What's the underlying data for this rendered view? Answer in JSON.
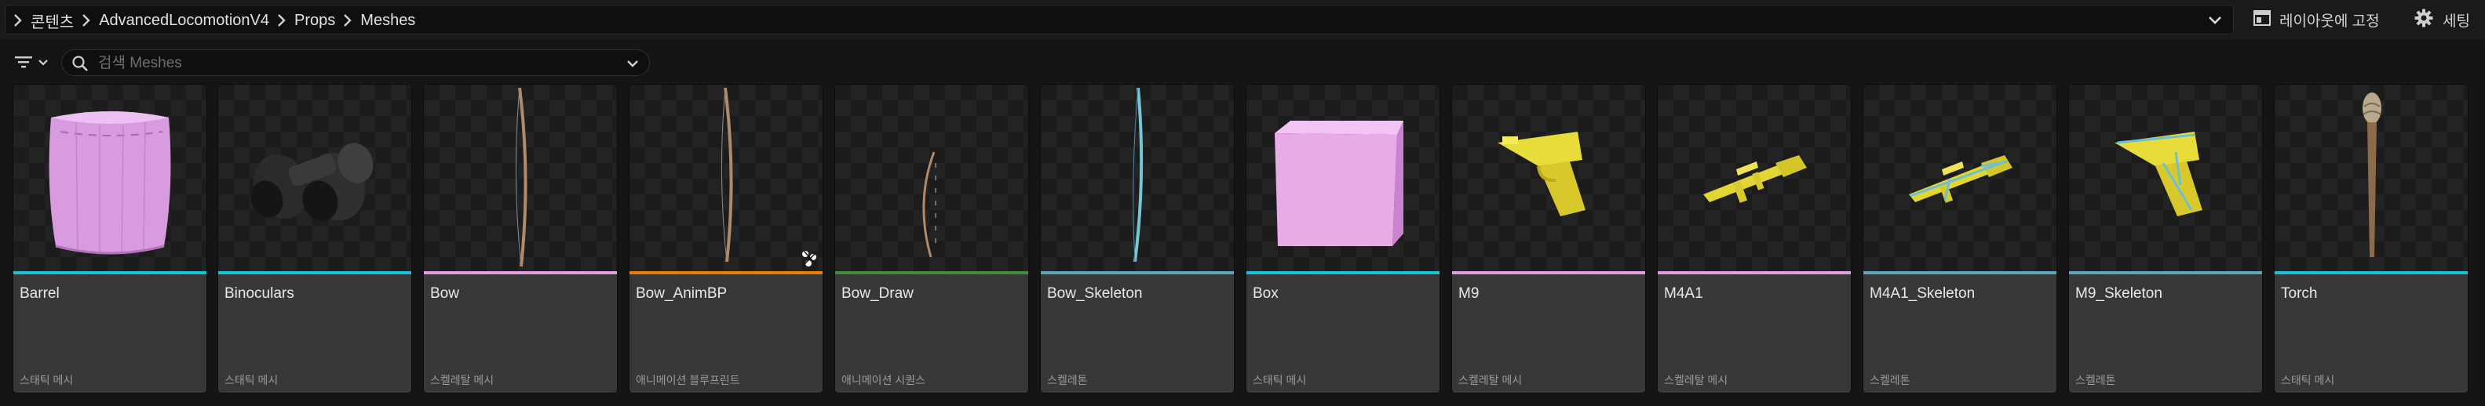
{
  "breadcrumb": {
    "items": [
      "콘텐츠",
      "AdvancedLocomotionV4",
      "Props",
      "Meshes"
    ]
  },
  "toolbar": {
    "lock_layout_label": "레이아웃에 고정",
    "settings_label": "세팅"
  },
  "search": {
    "placeholder": "검색 Meshes",
    "value": ""
  },
  "colors": {
    "static_mesh": "#19c2d6",
    "skeletal_mesh": "#e59ae6",
    "anim_blueprint": "#e67e00",
    "anim_sequence": "#3f8f3a",
    "skeleton": "#5fa4bd"
  },
  "assets": [
    {
      "name": "Barrel",
      "type": "스태틱 메시",
      "type_color": "#19c2d6",
      "thumbnail": "barrel-thumbnail"
    },
    {
      "name": "Binoculars",
      "type": "스태틱 메시",
      "type_color": "#19c2d6",
      "thumbnail": "binoculars-thumbnail"
    },
    {
      "name": "Bow",
      "type": "스켈레탈 메시",
      "type_color": "#e59ae6",
      "thumbnail": "bow-thumbnail"
    },
    {
      "name": "Bow_AnimBP",
      "type": "애니메이션 블루프린트",
      "type_color": "#e67e00",
      "thumbnail": "bow-thumbnail"
    },
    {
      "name": "Bow_Draw",
      "type": "애니메이션 시퀀스",
      "type_color": "#3f8f3a",
      "thumbnail": "bow-draw-thumbnail"
    },
    {
      "name": "Bow_Skeleton",
      "type": "스켈레톤",
      "type_color": "#5fa4bd",
      "thumbnail": "bow-skeleton-thumbnail"
    },
    {
      "name": "Box",
      "type": "스태틱 메시",
      "type_color": "#19c2d6",
      "thumbnail": "box-thumbnail"
    },
    {
      "name": "M9",
      "type": "스켈레탈 메시",
      "type_color": "#e59ae6",
      "thumbnail": "pistol-thumbnail"
    },
    {
      "name": "M4A1",
      "type": "스켈레탈 메시",
      "type_color": "#e59ae6",
      "thumbnail": "rifle-thumbnail"
    },
    {
      "name": "M4A1_Skeleton",
      "type": "스켈레톤",
      "type_color": "#5fa4bd",
      "thumbnail": "rifle-skeleton-thumbnail"
    },
    {
      "name": "M9_Skeleton",
      "type": "스켈레톤",
      "type_color": "#5fa4bd",
      "thumbnail": "pistol-skeleton-thumbnail"
    },
    {
      "name": "Torch",
      "type": "스태틱 메시",
      "type_color": "#19c2d6",
      "thumbnail": "torch-thumbnail"
    }
  ]
}
